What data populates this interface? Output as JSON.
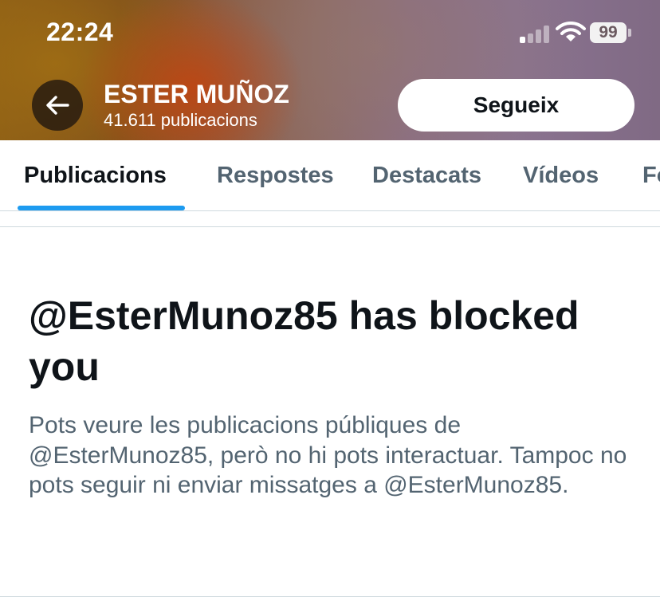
{
  "status_bar": {
    "time": "22:24",
    "battery": "99"
  },
  "header": {
    "back_icon": "arrow-left-icon",
    "name": "ESTER MUÑOZ",
    "post_count": "41.611 publicacions",
    "follow_label": "Segueix"
  },
  "tabs": [
    {
      "label": "Publicacions",
      "active": true
    },
    {
      "label": "Respostes",
      "active": false
    },
    {
      "label": "Destacats",
      "active": false
    },
    {
      "label": "Vídeos",
      "active": false
    },
    {
      "label": "Fo",
      "active": false
    }
  ],
  "blocked": {
    "title": "@EsterMunoz85 has blocked you",
    "description": "Pots veure les publicacions públiques de @EsterMunoz85, però no hi pots interactuar. Tampoc no pots seguir ni enviar missatges a @EsterMunoz85."
  },
  "colors": {
    "accent": "#1d9bf0",
    "text_primary": "#0f1419",
    "text_secondary": "#536471"
  }
}
